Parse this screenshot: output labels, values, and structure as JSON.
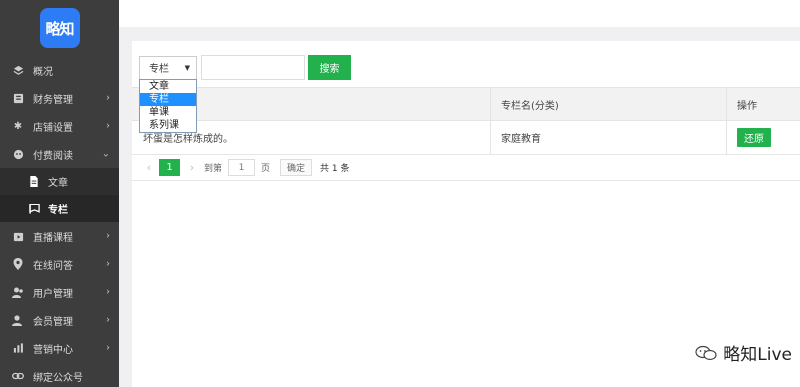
{
  "logo": {
    "text": "略知"
  },
  "sidebar": {
    "items": [
      {
        "label": "概况",
        "icon": "layers-icon",
        "chevron": false
      },
      {
        "label": "财务管理",
        "icon": "finance-icon",
        "chevron": true
      },
      {
        "label": "店铺设置",
        "icon": "gear-icon",
        "chevron": true
      },
      {
        "label": "付费阅读",
        "icon": "paid-read-icon",
        "chevron": true
      }
    ],
    "subitems": [
      {
        "label": "文章",
        "icon": "document-icon",
        "active": false
      },
      {
        "label": "专栏",
        "icon": "flag-icon",
        "active": true
      }
    ],
    "items2": [
      {
        "label": "直播课程",
        "icon": "live-icon",
        "chevron": true
      },
      {
        "label": "在线问答",
        "icon": "location-icon",
        "chevron": true
      },
      {
        "label": "用户管理",
        "icon": "user-icon",
        "chevron": true
      },
      {
        "label": "会员管理",
        "icon": "member-icon",
        "chevron": true
      },
      {
        "label": "营销中心",
        "icon": "chart-icon",
        "chevron": true
      },
      {
        "label": "绑定公众号",
        "icon": "link-icon",
        "chevron": false
      }
    ]
  },
  "filter": {
    "select_value": "专栏",
    "options": [
      "文章",
      "专栏",
      "单课",
      "系列课"
    ],
    "selected_index": 1,
    "search_label": "搜索"
  },
  "table": {
    "headers": [
      "",
      "专栏名(分类)",
      "操作"
    ],
    "rows": [
      {
        "title": "坏蛋是怎样炼成的。",
        "category": "家庭教育",
        "action": "还原"
      }
    ]
  },
  "pager": {
    "current": "1",
    "goto_label": "到第",
    "page_input": "1",
    "page_label": "页",
    "ok_label": "确定",
    "total": "共 1 条"
  },
  "watermark": {
    "text": "略知Live"
  },
  "colors": {
    "accent": "#23b14d",
    "sidebar_bg": "#3d3d3d",
    "logo_bg": "#2d7cf6",
    "dropdown_selected": "#1e90ff"
  }
}
